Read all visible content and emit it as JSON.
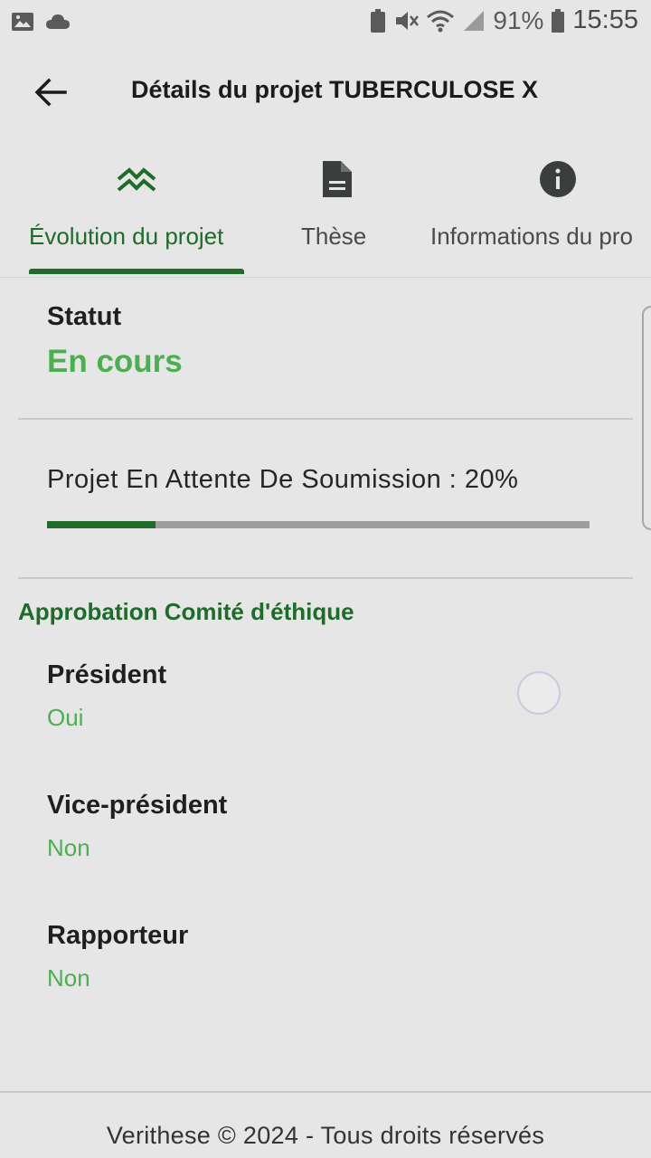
{
  "status_bar": {
    "battery": "91%",
    "time": "15:55"
  },
  "app_bar": {
    "title": "Détails du projet TUBERCULOSE X"
  },
  "tabs": [
    {
      "label": "Évolution du projet",
      "icon": "double-chevron-up-icon",
      "active": true
    },
    {
      "label": "Thèse",
      "icon": "document-icon",
      "active": false
    },
    {
      "label": "Informations du pro",
      "icon": "info-icon",
      "active": false
    }
  ],
  "status": {
    "label": "Statut",
    "value": "En cours"
  },
  "progress": {
    "text": "Projet En Attente De Soumission : 20%",
    "value": 0.2
  },
  "approval": {
    "title": "Approbation Comité d'éthique",
    "items": [
      {
        "label": "Président",
        "value": "Oui"
      },
      {
        "label": "Vice-président",
        "value": "Non"
      },
      {
        "label": "Rapporteur",
        "value": "Non"
      }
    ]
  },
  "footer": {
    "text": "Verithese © 2024 - Tous droits réservés"
  },
  "colors": {
    "accent": "#1e6b2a",
    "status_green": "#4caf50",
    "background": "#e6e6e6"
  }
}
